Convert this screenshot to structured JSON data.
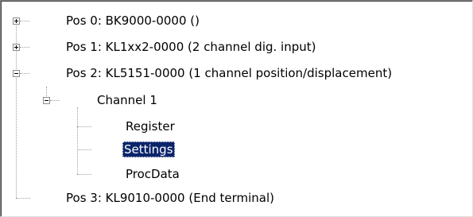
{
  "tree": {
    "pos0": {
      "label": "Pos 0: BK9000-0000 ()",
      "state": "collapsed"
    },
    "pos1": {
      "label": "Pos 1: KL1xx2-0000 (2 channel dig. input)",
      "state": "collapsed"
    },
    "pos2": {
      "label": "Pos 2: KL5151-0000 (1 channel position/displacement)",
      "state": "expanded",
      "channel1": {
        "label": "Channel 1",
        "state": "expanded",
        "children": [
          "Register",
          "Settings",
          "ProcData"
        ],
        "selected": "Settings"
      }
    },
    "pos3": {
      "label": "Pos 3: KL9010-0000  (End terminal)"
    }
  }
}
